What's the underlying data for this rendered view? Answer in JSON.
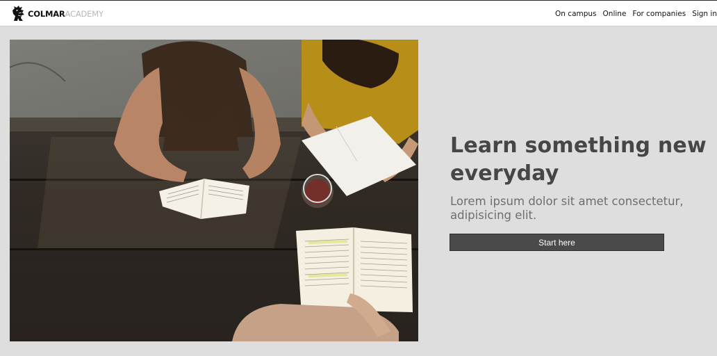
{
  "header": {
    "logo": {
      "icon": "rearing-lion-crest-icon",
      "brand": "COLMAR",
      "sub": "ACADEMY"
    },
    "nav": [
      {
        "label": "On campus"
      },
      {
        "label": "Online"
      },
      {
        "label": "For companies"
      },
      {
        "label": "Sign in"
      }
    ]
  },
  "hero": {
    "image": "hero-photo: students reading and writing at a wooden picnic table",
    "headline": "Learn something new everyday",
    "subline": "Lorem ipsum dolor sit amet consectetur, adipisicing elit.",
    "cta_label": "Start here"
  },
  "colors": {
    "page_background": "#dedede",
    "header_background": "#ffffff",
    "headline": "#464646",
    "subline": "#6e6e6e",
    "button_background": "#4a4a4a",
    "button_text": "#ffffff",
    "logo_accent": "#b8b8b8"
  }
}
